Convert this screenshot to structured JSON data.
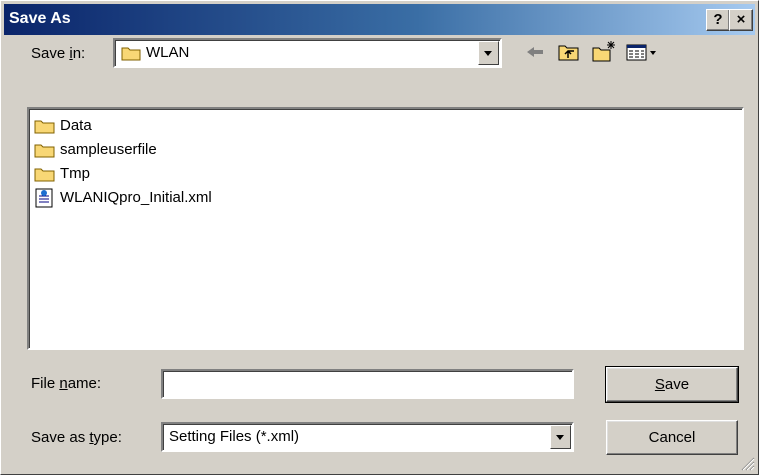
{
  "window": {
    "title": "Save As",
    "help_label": "?",
    "close_label": "×"
  },
  "save_in": {
    "label_pre": "Save ",
    "label_accel": "i",
    "label_post": "n:",
    "value": "WLAN"
  },
  "files": [
    {
      "name": "Data",
      "icon": "folder-icon"
    },
    {
      "name": "sampleuserfile",
      "icon": "folder-icon"
    },
    {
      "name": "Tmp",
      "icon": "folder-icon"
    },
    {
      "name": "WLANIQpro_Initial.xml",
      "icon": "xml-file-icon"
    }
  ],
  "file_name": {
    "label_pre": "File ",
    "label_accel": "n",
    "label_post": "ame:",
    "value": ""
  },
  "save_as_type": {
    "label_pre": "Save as ",
    "label_accel": "t",
    "label_post": "ype:",
    "value": "Setting Files (*.xml)"
  },
  "buttons": {
    "save_accel": "S",
    "save_rest": "ave",
    "cancel": "Cancel"
  },
  "colors": {
    "face": "#d4d0c8",
    "title_start": "#0a246a",
    "title_end": "#a6caf0",
    "folder": "#f8d775"
  }
}
